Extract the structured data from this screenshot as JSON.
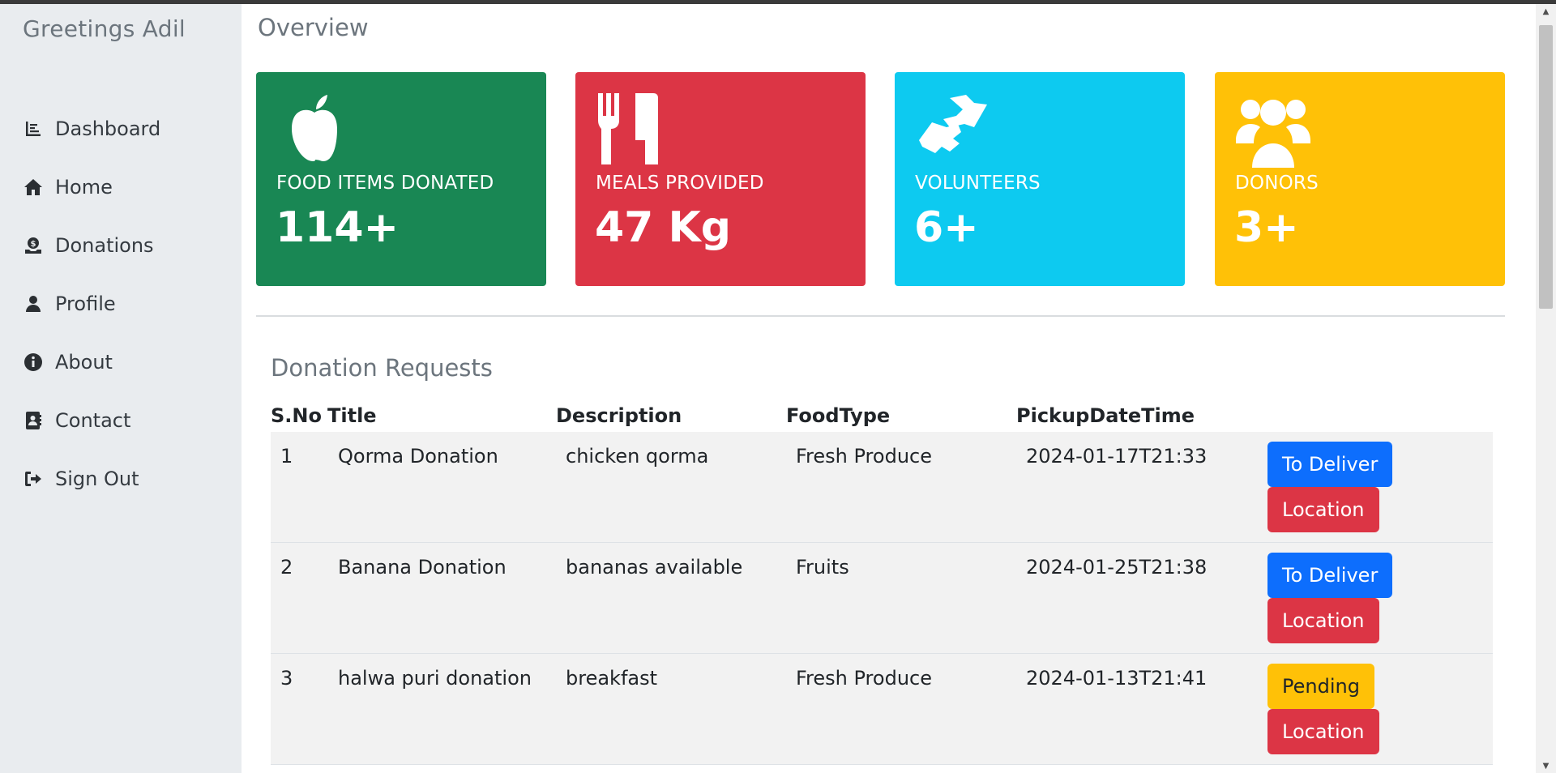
{
  "sidebar": {
    "greeting": "Greetings Adil",
    "items": [
      {
        "label": "Dashboard",
        "icon": "chart-icon"
      },
      {
        "label": "Home",
        "icon": "home-icon"
      },
      {
        "label": "Donations",
        "icon": "donation-icon"
      },
      {
        "label": "Profile",
        "icon": "user-icon"
      },
      {
        "label": "About",
        "icon": "info-icon"
      },
      {
        "label": "Contact",
        "icon": "contact-icon"
      },
      {
        "label": "Sign Out",
        "icon": "sign-out-icon"
      }
    ]
  },
  "overview": {
    "title": "Overview",
    "cards": [
      {
        "label": "FOOD ITEMS DONATED",
        "value": "114+",
        "icon": "apple-icon",
        "color": "#198754"
      },
      {
        "label": "MEALS PROVIDED",
        "value": "47 Kg",
        "icon": "utensils-icon",
        "color": "#dc3545"
      },
      {
        "label": "VOLUNTEERS",
        "value": "6+",
        "icon": "handshake-icon",
        "color": "#0dcaf0"
      },
      {
        "label": "DONORS",
        "value": "3+",
        "icon": "users-icon",
        "color": "#ffc107"
      }
    ]
  },
  "requests": {
    "title": "Donation Requests",
    "headers": [
      "S.No",
      "Title",
      "Description",
      "FoodType",
      "PickupDateTime"
    ],
    "rows": [
      {
        "sno": "1",
        "title": "Qorma Donation",
        "description": "chicken qorma",
        "food_type": "Fresh Produce",
        "pickup": "2024-01-17T21:33",
        "status_label": "To Deliver",
        "location_label": "Location"
      },
      {
        "sno": "2",
        "title": "Banana Donation",
        "description": "bananas available",
        "food_type": "Fruits",
        "pickup": "2024-01-25T21:38",
        "status_label": "To Deliver",
        "location_label": "Location"
      },
      {
        "sno": "3",
        "title": "halwa puri donation",
        "description": "breakfast",
        "food_type": "Fresh Produce",
        "pickup": "2024-01-13T21:41",
        "status_label": "Pending",
        "location_label": "Location"
      }
    ]
  }
}
